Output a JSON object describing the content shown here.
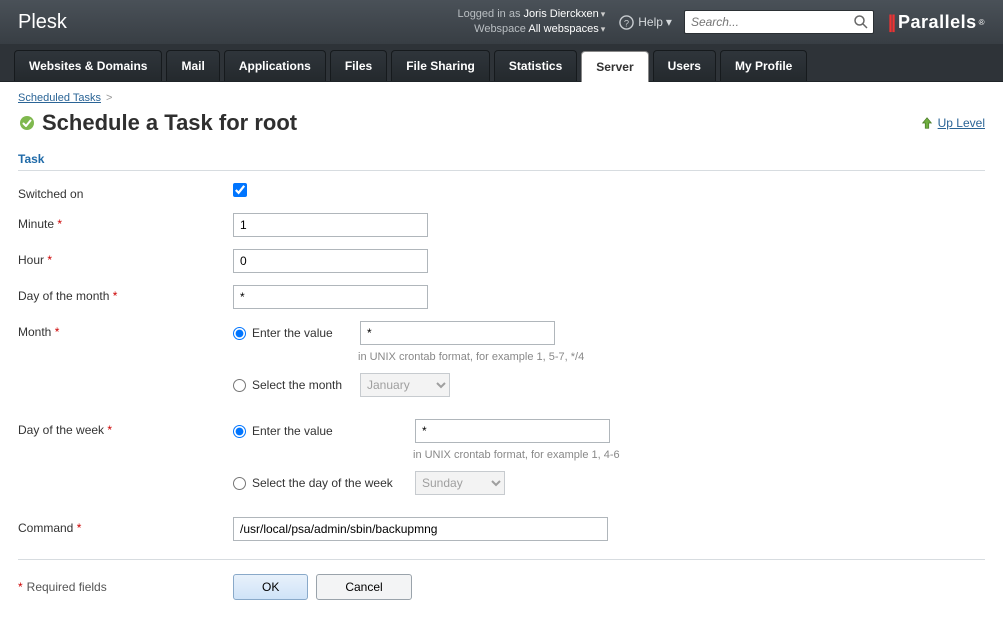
{
  "header": {
    "brand": "Plesk",
    "loggedInLabel": "Logged in as",
    "loggedInUser": "Joris Dierckxen",
    "webspaceLabel": "Webspace",
    "webspaceValue": "All webspaces",
    "helpLabel": "Help",
    "searchPlaceholder": "Search...",
    "partnerBrand": "Parallels"
  },
  "nav": {
    "tabs": [
      {
        "label": "Websites & Domains"
      },
      {
        "label": "Mail"
      },
      {
        "label": "Applications"
      },
      {
        "label": "Files"
      },
      {
        "label": "File Sharing"
      },
      {
        "label": "Statistics"
      },
      {
        "label": "Server"
      },
      {
        "label": "Users"
      },
      {
        "label": "My Profile"
      }
    ],
    "activeIndex": 6
  },
  "breadcrumb": {
    "parent": "Scheduled Tasks",
    "sep": ">"
  },
  "page": {
    "title": "Schedule a Task for root",
    "upLevel": "Up Level",
    "sectionTitle": "Task"
  },
  "form": {
    "switchedOnLabel": "Switched on",
    "switchedOnChecked": true,
    "minuteLabel": "Minute",
    "minuteValue": "1",
    "hourLabel": "Hour",
    "hourValue": "0",
    "domLabel": "Day of the month",
    "domValue": "*",
    "monthLabel": "Month",
    "monthEnterLabel": "Enter the value",
    "monthEnterValue": "*",
    "monthHint": "in UNIX crontab format, for example 1, 5-7, */4",
    "monthSelectLabel": "Select the month",
    "monthSelectValue": "January",
    "dowLabel": "Day of the week",
    "dowEnterLabel": "Enter the value",
    "dowEnterValue": "*",
    "dowHint": "in UNIX crontab format, for example 1, 4-6",
    "dowSelectLabel": "Select the day of the week",
    "dowSelectValue": "Sunday",
    "commandLabel": "Command",
    "commandValue": "/usr/local/psa/admin/sbin/backupmng",
    "requiredNote": "Required fields",
    "okLabel": "OK",
    "cancelLabel": "Cancel"
  }
}
